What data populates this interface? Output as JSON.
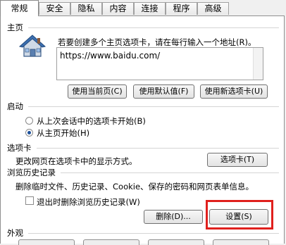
{
  "tabs": [
    "常规",
    "安全",
    "隐私",
    "内容",
    "连接",
    "程序",
    "高级"
  ],
  "home": {
    "section_title": "主页",
    "description": "若要创建多个主页选项卡，请在每行输入一个地址(R)。",
    "url": "https://www.baidu.com/",
    "icon": "house-icon",
    "btn_current": "使用当前页(C)",
    "btn_default": "使用默认值(F)",
    "btn_newtab": "使用新选项卡(U)"
  },
  "startup": {
    "section_title": "启动",
    "option1": "从上次会话中的选项卡开始(B)",
    "option2": "从主页开始(H)",
    "selected": "option2"
  },
  "tabs_section": {
    "section_title": "选项卡",
    "description": "更改网页在选项卡中的显示方式。",
    "btn": "选项卡(T)"
  },
  "history": {
    "section_title": "浏览历史记录",
    "description": "删除临时文件、历史记录、Cookie、保存的密码和网页表单信息。",
    "checkbox_label": "退出时删除浏览历史记录(W)",
    "checked": false,
    "btn_delete": "删除(D)...",
    "btn_settings": "设置(S)"
  },
  "appearance": {
    "section_title": "外观"
  },
  "colors": {
    "highlight": "#e0201d",
    "radio_dot": "#1b4f9a"
  }
}
